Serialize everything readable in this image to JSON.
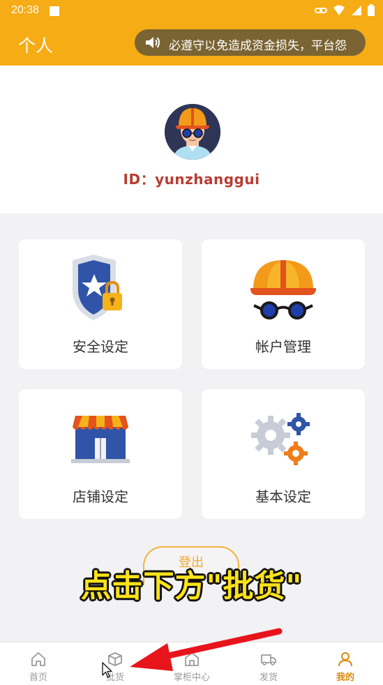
{
  "status_bar": {
    "time": "20:38"
  },
  "header": {
    "title": "个人",
    "notice": "必遵守以免造成资金损失，平台怨"
  },
  "profile": {
    "id_text": "ID：yunzhanggui"
  },
  "cards": [
    {
      "label": "安全设定",
      "icon": "shield-lock-icon"
    },
    {
      "label": "帐户管理",
      "icon": "account-cap-icon"
    },
    {
      "label": "店铺设定",
      "icon": "store-icon"
    },
    {
      "label": "基本设定",
      "icon": "gears-icon"
    }
  ],
  "logout_label": "登出",
  "caption": "点击下方\"批货\"",
  "bottom_nav": [
    {
      "label": "首页",
      "icon": "home-icon"
    },
    {
      "label": "批货",
      "icon": "box-icon"
    },
    {
      "label": "掌柜中心",
      "icon": "shop-center-icon"
    },
    {
      "label": "发货",
      "icon": "truck-icon"
    },
    {
      "label": "我的",
      "icon": "person-icon",
      "active": true
    }
  ],
  "colors": {
    "brand": "#f6ac14",
    "id_text": "#b73d31",
    "active_nav": "#d78a10",
    "arrow": "#e8141c",
    "caption": "#ffe319"
  }
}
